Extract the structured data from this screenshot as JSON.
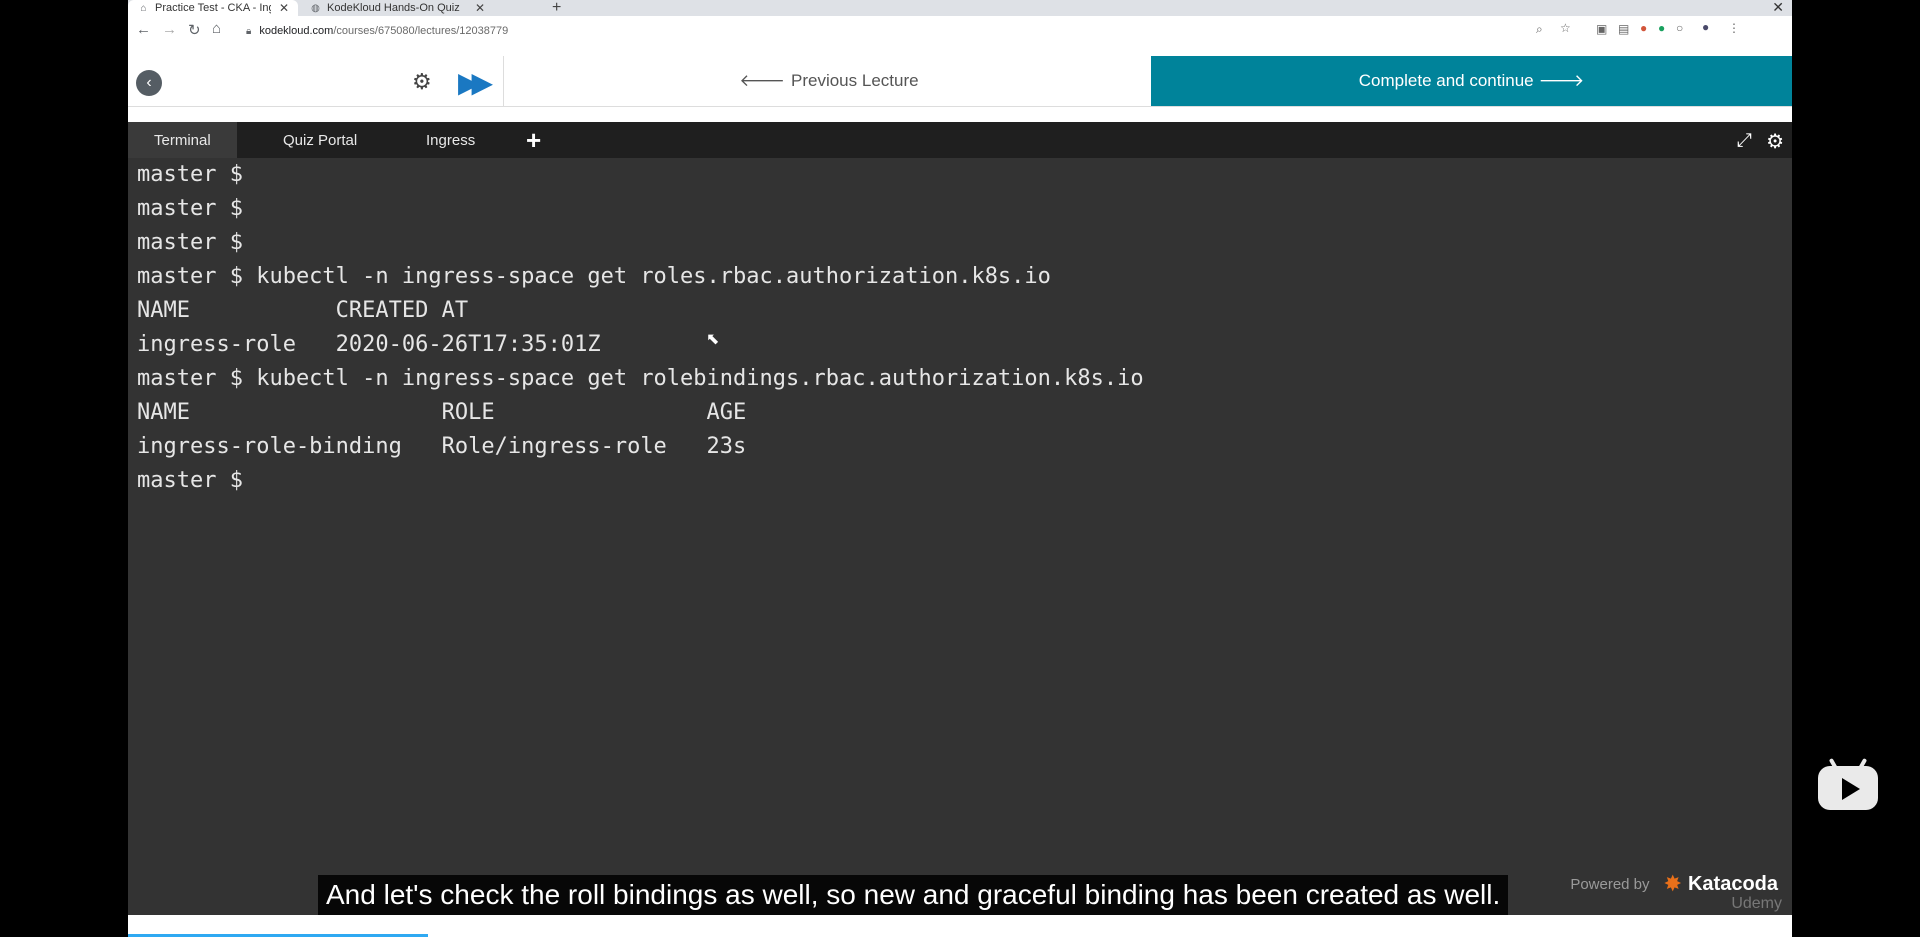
{
  "browser": {
    "tabs": [
      {
        "label": "Practice Test - CKA - Ingress N",
        "icon": "house-icon",
        "active": true
      },
      {
        "label": "KodeKloud Hands-On Quiz",
        "icon": "globe-icon",
        "active": false
      }
    ],
    "url_domain": "kodekloud.com",
    "url_path": "/courses/675080/lectures/12038779"
  },
  "lecture": {
    "previous_label": "Previous Lecture",
    "complete_label": "Complete and continue"
  },
  "terminal": {
    "tabs": [
      "Terminal",
      "Quiz Portal",
      "Ingress"
    ],
    "lines": [
      "master $",
      "master $",
      "master $",
      "master $ kubectl -n ingress-space get roles.rbac.authorization.k8s.io",
      "NAME           CREATED AT",
      "ingress-role   2020-06-26T17:35:01Z",
      "master $ kubectl -n ingress-space get rolebindings.rbac.authorization.k8s.io",
      "NAME                   ROLE                AGE",
      "ingress-role-binding   Role/ingress-role   23s",
      "master $"
    ]
  },
  "footer": {
    "powered_by": "Powered by",
    "brand": "Katacoda",
    "watermark": "Udemy"
  },
  "video": {
    "subtitle": "And let's check the roll bindings as well, so new and graceful binding has been created as well.",
    "progress_fraction": 0.18
  },
  "colors": {
    "accent": "#00839a",
    "terminal_bg": "#333333",
    "progress": "#2fa9f2"
  }
}
